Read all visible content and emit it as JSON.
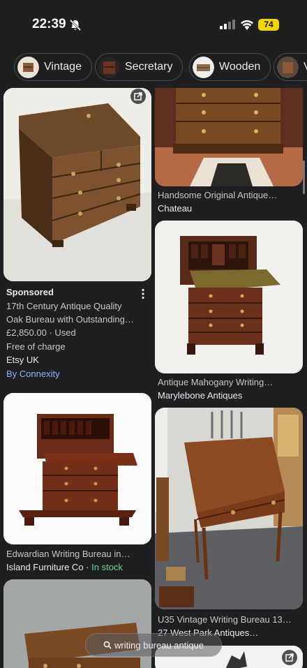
{
  "status_bar": {
    "time": "22:39",
    "battery": "74"
  },
  "chips": [
    {
      "label": "Vintage"
    },
    {
      "label": "Secretary"
    },
    {
      "label": "Wooden"
    },
    {
      "label": "V"
    }
  ],
  "results": [
    {
      "title": "Handsome Original Antique…",
      "source": "Chateau"
    },
    {
      "title": "Antique Mahogany Writing…",
      "source": "Marylebone Antiques"
    },
    {
      "title": "Edwardian Writing Bureau in…",
      "source": "Island Furniture Co",
      "separator": " · ",
      "stock": "In stock"
    },
    {
      "title": "U35 Vintage Writing Bureau 13…",
      "source": "27 West Park Antiques…"
    }
  ],
  "sponsored": {
    "label": "Sponsored",
    "title_line1": "17th Century Antique Quality",
    "title_line2": "Oak Bureau with Outstanding…",
    "price": "£2,850.00 · Used",
    "shipping": "Free of charge",
    "merchant": "Etsy UK",
    "by": "By Connexity"
  },
  "search": {
    "query": "writing bureau antique"
  },
  "colors": {
    "background": "#1f1f21",
    "link": "#8ab4f8",
    "in_stock": "#6dd58c",
    "battery": "#f2d600"
  },
  "icons": [
    "bell-off-icon",
    "signal-icon",
    "wifi-icon",
    "battery-icon",
    "external-link-icon",
    "more-vert-icon",
    "search-icon"
  ]
}
